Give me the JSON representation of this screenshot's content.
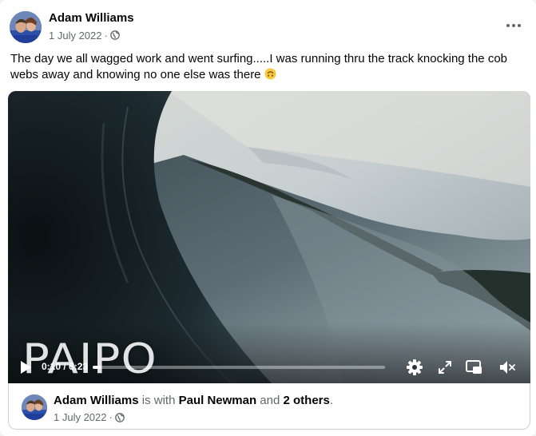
{
  "post": {
    "author": "Adam Williams",
    "date": "1 July 2022",
    "separator": "·",
    "privacy_icon": "globe-icon",
    "more_icon": "more-options-icon",
    "text": "The day we all wagged work and went surfing.....I was running thru the track knocking the cob webs away and knowing no one else was there",
    "emoji": "upside-down-face-emoji"
  },
  "video": {
    "watermark": "PAIPO",
    "time": "0:10 / 6:23",
    "progress": 0.026,
    "controls": [
      "play-icon",
      "settings-gear-icon",
      "fullscreen-icon",
      "picture-in-picture-icon",
      "muted-speaker-icon"
    ]
  },
  "footer": {
    "author": "Adam Williams",
    "with_text": "is with",
    "tagged": "Paul Newman",
    "and_text": "and",
    "others": "2 others",
    "period": ".",
    "date": "1 July 2022",
    "separator": "·"
  }
}
